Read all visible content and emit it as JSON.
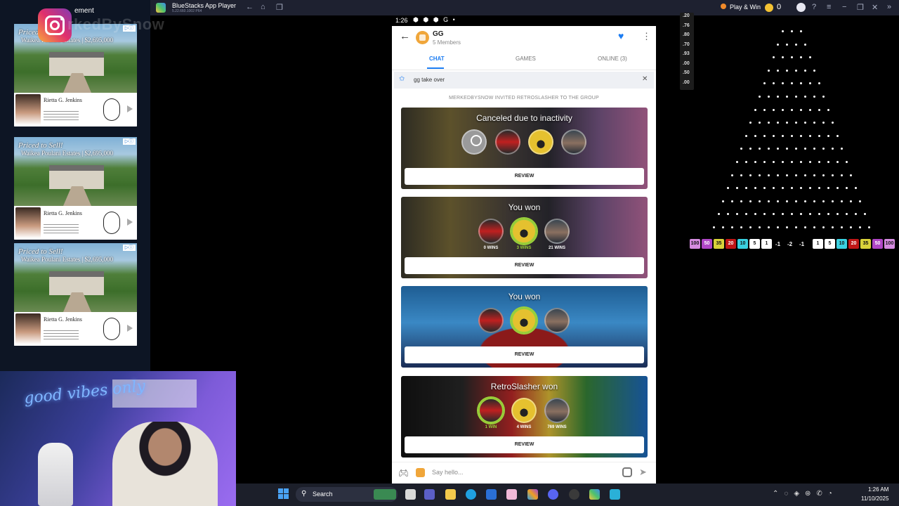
{
  "left": {
    "advertisement_label": "ement",
    "instagram_handle": "rkedBySnow",
    "ads": [
      {
        "headline": "Priced to Sell!",
        "sub": "Waikea Poulani Estates | $2,695,000",
        "agent": "Rietta G. Jenkins",
        "brand": "COLDWELL BANKER"
      },
      {
        "headline": "Priced to Sell!",
        "sub": "Waikea Poulani Estates | $2,695,000",
        "agent": "Rietta G. Jenkins",
        "brand": "COLDWELL BANKER"
      },
      {
        "headline": "Priced to Sell!",
        "sub": "Waikea Poulani Estates | $2,695,000",
        "agent": "Rietta G. Jenkins",
        "brand": "COLDWELL BANKER"
      }
    ],
    "neon_sign": "good vibes only"
  },
  "bluestacks": {
    "title": "BlueStacks App Player",
    "version": "5.22.660.1002 P64",
    "play_win": "Play & Win",
    "coins": "0"
  },
  "phone": {
    "status_time": "1:26",
    "status_icons": "⬢ ⬢ ⬢ G •",
    "group_name": "GG",
    "members": "5 Members",
    "tabs": {
      "chat": "CHAT",
      "games": "GAMES",
      "online": "ONLINE (3)"
    },
    "pinned": "gg take over",
    "system_message": "MERKEDBYSNOW INVITED RETROSLASHER TO THE GROUP",
    "cards": [
      {
        "headline": "Canceled due to inactivity",
        "review": "REVIEW"
      },
      {
        "headline": "You won",
        "wins": [
          "0 WINS",
          "3 WINS",
          "21 WINS"
        ],
        "review": "REVIEW"
      },
      {
        "headline": "You won",
        "review": "REVIEW"
      },
      {
        "headline": "RetroSlasher won",
        "wins": [
          "1 WIN",
          "4 WINS",
          "769 WINS"
        ],
        "review": "REVIEW"
      }
    ],
    "composer_placeholder": "Say hello..."
  },
  "plinko": {
    "multipliers_side": [
      ".20",
      ".76",
      ".80",
      ".70",
      ".93",
      ".00",
      ".50",
      ".00"
    ],
    "slots": [
      {
        "v": "100",
        "c": "#d58ce0"
      },
      {
        "v": "50",
        "c": "#b046c6"
      },
      {
        "v": "35",
        "c": "#d9d23a"
      },
      {
        "v": "20",
        "c": "#c01616"
      },
      {
        "v": "10",
        "c": "#3ad0e0"
      },
      {
        "v": "5",
        "c": "#ffffff"
      },
      {
        "v": "1",
        "c": "#ffffff"
      }
    ],
    "middle": [
      "-1",
      "-2",
      "-1"
    ],
    "slots_right": [
      {
        "v": "1",
        "c": "#ffffff"
      },
      {
        "v": "5",
        "c": "#ffffff"
      },
      {
        "v": "10",
        "c": "#3ad0e0"
      },
      {
        "v": "20",
        "c": "#c01616"
      },
      {
        "v": "35",
        "c": "#d9d23a"
      },
      {
        "v": "50",
        "c": "#b046c6"
      },
      {
        "v": "100",
        "c": "#d58ce0"
      }
    ]
  },
  "taskbar": {
    "search": "Search",
    "time": "1:26 AM",
    "date": "11/10/2025"
  }
}
